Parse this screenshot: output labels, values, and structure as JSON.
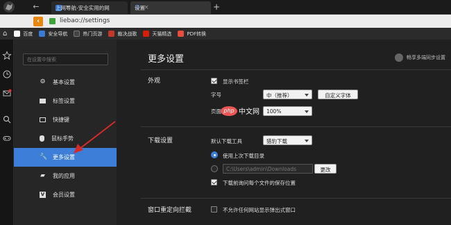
{
  "tabs": [
    {
      "label": "上网导航-安全实用的网",
      "close": "×"
    },
    {
      "label": "设置",
      "close": "×"
    }
  ],
  "new_tab": "+",
  "address": {
    "url": "liebao://settings"
  },
  "bookmarks": [
    {
      "label": "百度",
      "color": "#ffffff"
    },
    {
      "label": "安全导航",
      "color": "#3a7bd5"
    },
    {
      "label": "热门页游",
      "color": "#333333"
    },
    {
      "label": "裁决战歌",
      "color": "#c0392b"
    },
    {
      "label": "天猫精选",
      "color": "#d81e06"
    },
    {
      "label": "PDF转换",
      "color": "#e74c3c"
    }
  ],
  "sidebar": {
    "search_placeholder": "在设置中搜索",
    "items": [
      {
        "label": "基本设置",
        "icon": "gear-icon"
      },
      {
        "label": "标签设置",
        "icon": "tab-icon"
      },
      {
        "label": "快捷键",
        "icon": "keyboard-icon"
      },
      {
        "label": "鼠标手势",
        "icon": "mouse-icon"
      },
      {
        "label": "更多设置",
        "icon": "wrench-icon",
        "active": true
      },
      {
        "label": "我的应用",
        "icon": "apps-icon"
      },
      {
        "label": "会员设置",
        "icon": "vip-icon"
      }
    ]
  },
  "main": {
    "title": "更多设置",
    "sync_label": "畅享多端同步设置",
    "appearance": {
      "section": "外观",
      "show_bookmarks_bar": "显示书签栏",
      "font_size_label": "字号",
      "font_size_value": "中（推荐）",
      "custom_font_button": "自定义字体",
      "zoom_label": "页面缩放",
      "zoom_value": "100%"
    },
    "download": {
      "section": "下载设置",
      "default_tool_label": "默认下载工具",
      "default_tool_value": "猎豹下载",
      "use_last_dir": "使用上次下载目录",
      "path_value": "C:\\Users\\admin\\Downloads",
      "change_button": "更改",
      "ask_each_time": "下载前询问每个文件的保存位置"
    },
    "popup": {
      "section": "窗口重定向拦截",
      "block_popups": "不允许任何网站显示弹出式窗口"
    }
  },
  "watermark": {
    "logo": "php",
    "text": "中文网"
  },
  "colors": {
    "accent": "#3d7ed8",
    "arrow": "#d42a2a"
  }
}
